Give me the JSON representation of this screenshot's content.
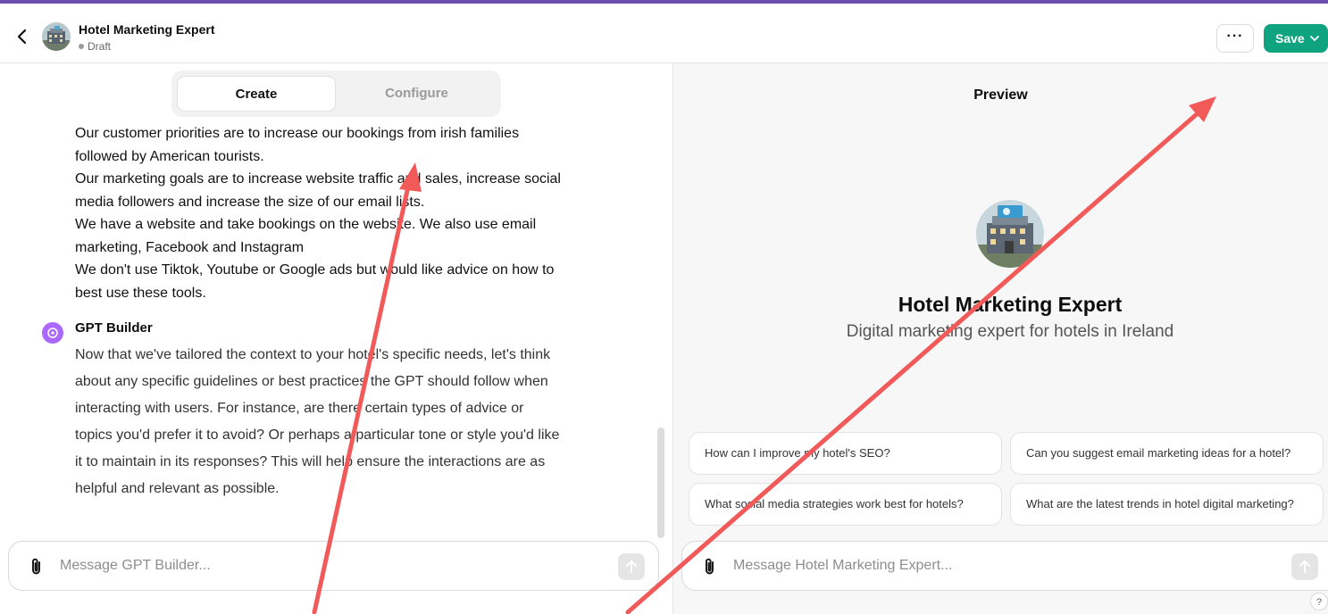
{
  "header": {
    "title": "Hotel Marketing Expert",
    "status": "Draft",
    "more_label": "···",
    "save_label": "Save"
  },
  "tabs": [
    {
      "label": "Create",
      "active": true
    },
    {
      "label": "Configure",
      "active": false
    }
  ],
  "chat": {
    "user_message": [
      "Our customer priorities are to increase our bookings from irish families followed by American tourists.",
      "Our marketing goals are to increase website traffic and sales, increase social media followers and increase the size of our email lists.",
      "We have a website and take bookings on the website. We also use email marketing, Facebook and Instagram",
      "We  don't use Tiktok, Youtube or Google ads but would like advice on how to best use these tools."
    ],
    "assistant_name": "GPT Builder",
    "assistant_message": "Now that we've tailored the context to your hotel's specific needs, let's think about any specific guidelines or best practices the GPT should follow when interacting with users. For instance, are there certain types of advice or topics you'd prefer it to avoid? Or perhaps a particular tone or style you'd like it to maintain in its responses? This will help ensure the interactions are as helpful and relevant as possible.",
    "input_placeholder": "Message GPT Builder..."
  },
  "preview": {
    "label": "Preview",
    "gpt_name": "Hotel Marketing Expert",
    "gpt_description": "Digital marketing expert for hotels in Ireland",
    "suggestions": [
      "How can I improve my hotel's SEO?",
      "Can you suggest email marketing ideas for a hotel?",
      "What social media strategies work best for hotels?",
      "What are the latest trends in hotel digital marketing?"
    ],
    "input_placeholder": "Message Hotel Marketing Expert..."
  },
  "help_label": "?",
  "colors": {
    "accent_purple": "#6f4cb0",
    "save_green": "#10a37f",
    "annotation_red": "#f25a5a",
    "gpt_builder_icon": "#ab68ff"
  },
  "icons": [
    "back-chevron-icon",
    "paperclip-icon",
    "send-arrow-icon",
    "chevron-down-icon",
    "gpt-builder-icon"
  ]
}
